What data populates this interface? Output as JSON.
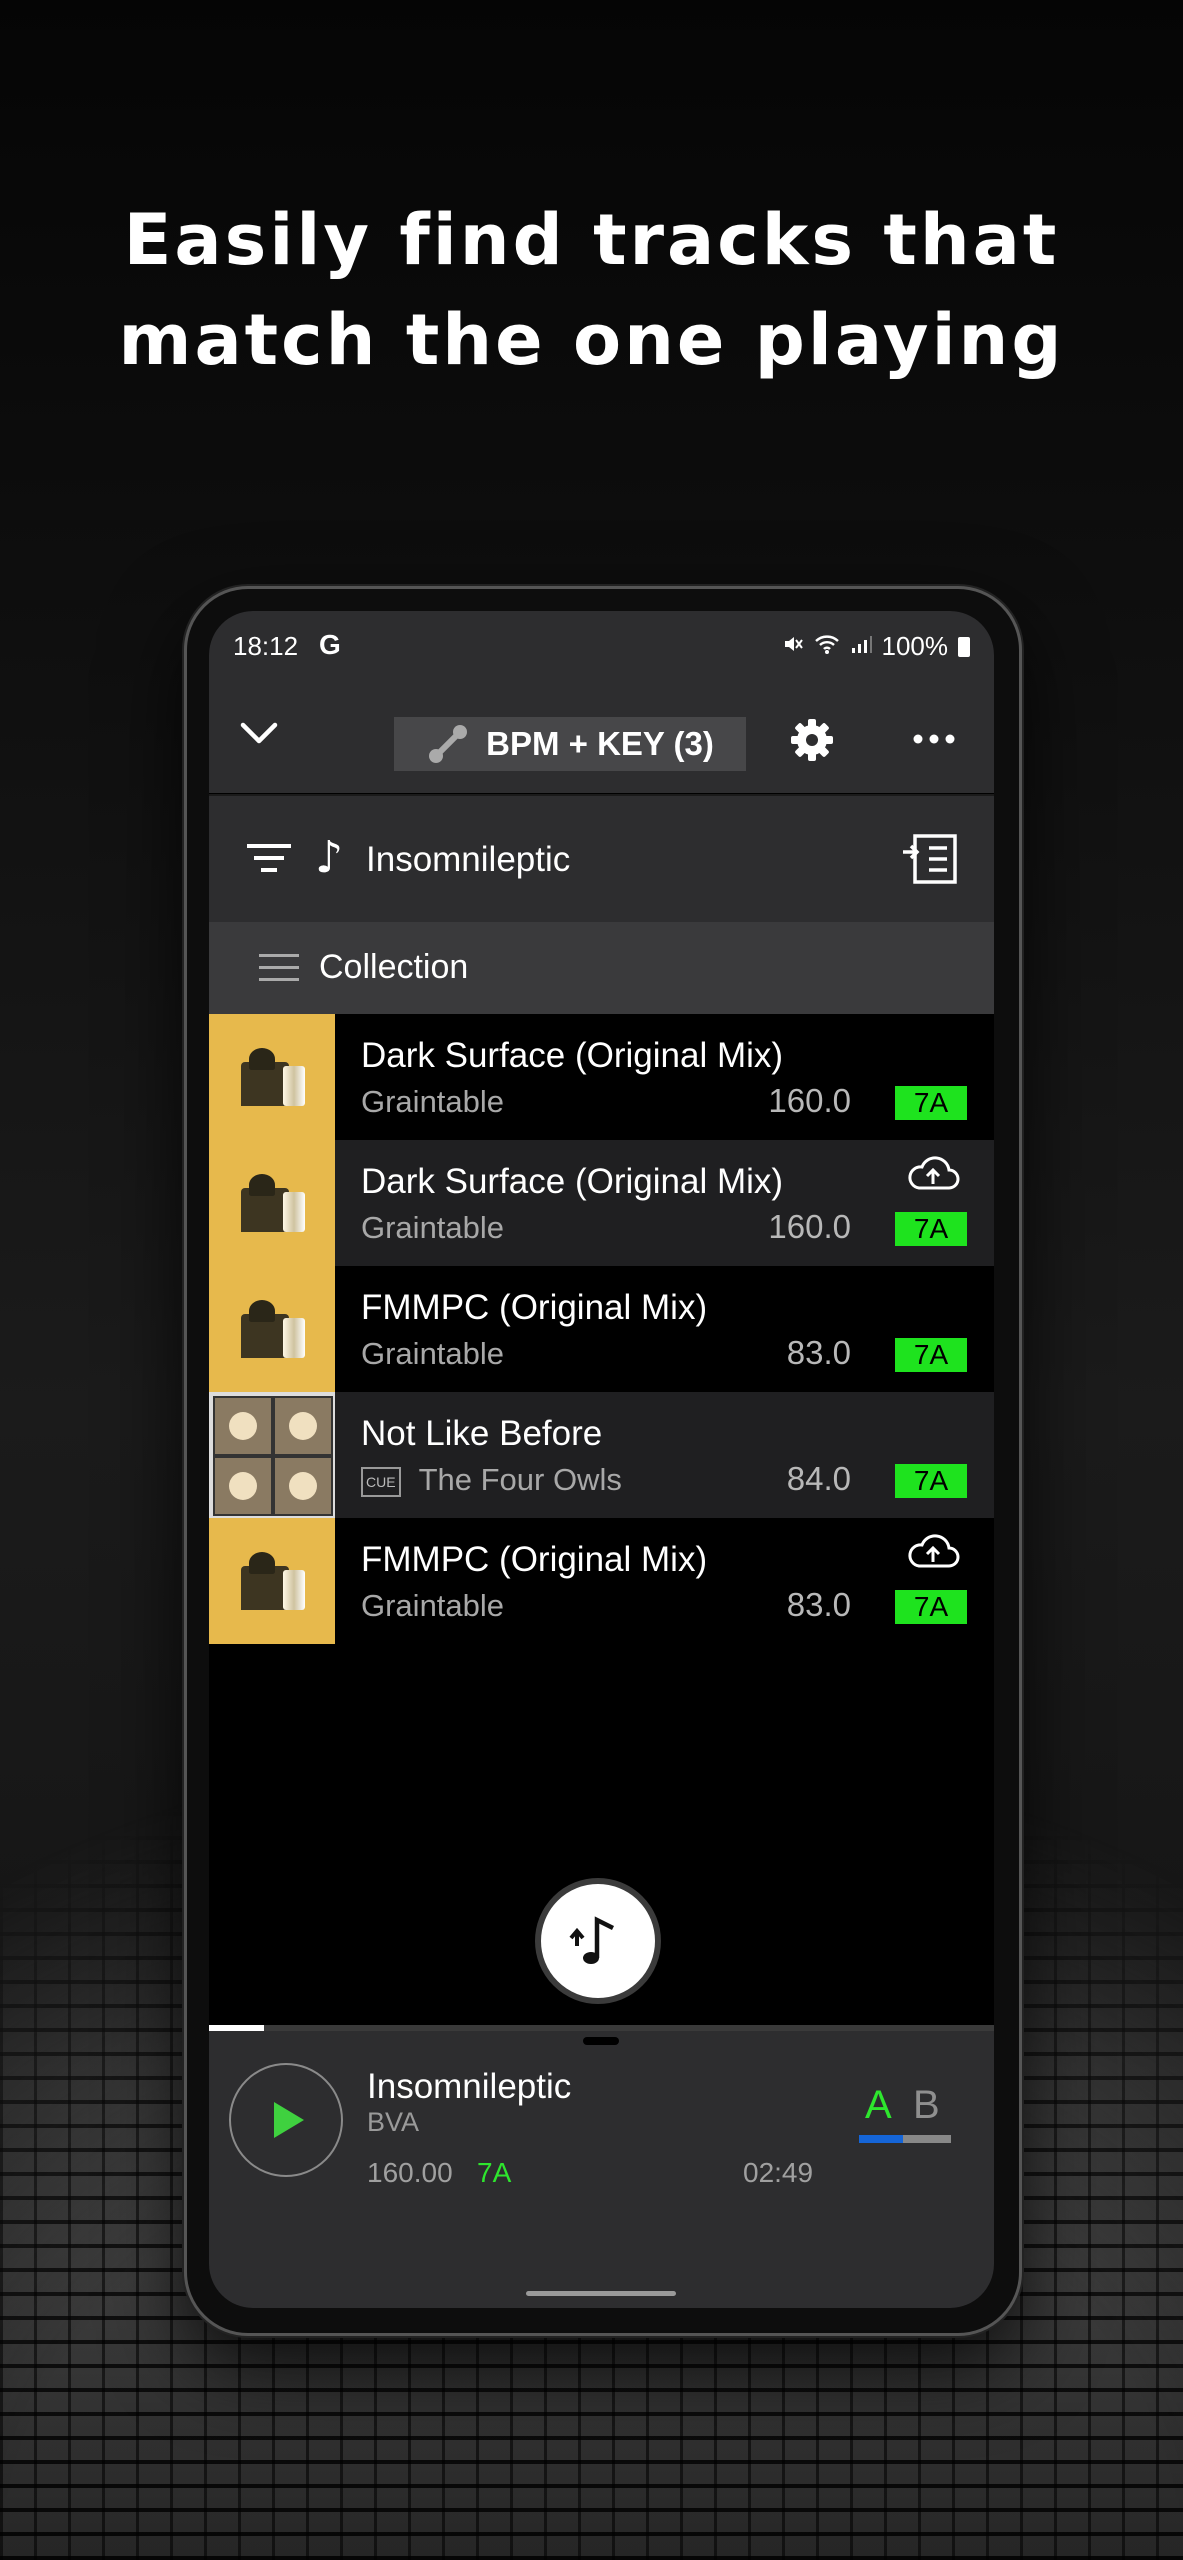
{
  "headline": [
    "Easily find tracks that",
    "match the one playing"
  ],
  "status_bar": {
    "time": "18:12",
    "carrier_logo": "G",
    "battery": "100%",
    "icons": [
      "mute-icon",
      "wifi-icon",
      "signal-icon",
      "battery-icon"
    ]
  },
  "app_bar": {
    "mode_label": "BPM + KEY (3)",
    "icons": [
      "chevron-down-icon",
      "match-link-icon",
      "gear-icon",
      "more-icon"
    ]
  },
  "filter_bar": {
    "reference_track": "Insomnileptic",
    "icons": [
      "filter-icon",
      "music-note-icon",
      "playlist-add-icon"
    ]
  },
  "collection": {
    "label": "Collection"
  },
  "tracks": [
    {
      "title": "Dark Surface (Original Mix)",
      "artist": "Graintable",
      "bpm": "160.0",
      "key": "7A",
      "cloud": false,
      "cue": false,
      "art": "yellow"
    },
    {
      "title": "Dark Surface (Original Mix)",
      "artist": "Graintable",
      "bpm": "160.0",
      "key": "7A",
      "cloud": true,
      "cue": false,
      "art": "yellow"
    },
    {
      "title": "FMMPC (Original Mix)",
      "artist": "Graintable",
      "bpm": "83.0",
      "key": "7A",
      "cloud": false,
      "cue": false,
      "art": "yellow"
    },
    {
      "title": "Not Like Before",
      "artist": "The Four Owls",
      "bpm": "84.0",
      "key": "7A",
      "cloud": false,
      "cue": true,
      "cue_label": "CUE",
      "art": "owls"
    },
    {
      "title": "FMMPC (Original Mix)",
      "artist": "Graintable",
      "bpm": "83.0",
      "key": "7A",
      "cloud": true,
      "cue": false,
      "art": "yellow"
    }
  ],
  "now_playing": {
    "title": "Insomnileptic",
    "artist": "BVA",
    "bpm": "160.00",
    "key": "7A",
    "time": "02:49",
    "progress": 0.07,
    "deck_a": "A",
    "deck_b": "B",
    "deck_a_level": 0.48
  },
  "colors": {
    "key_badge": "#1ee31e",
    "key_text": "#2ee62e",
    "deck_bar": "#1565d8",
    "panel": "#2d2d2f"
  }
}
